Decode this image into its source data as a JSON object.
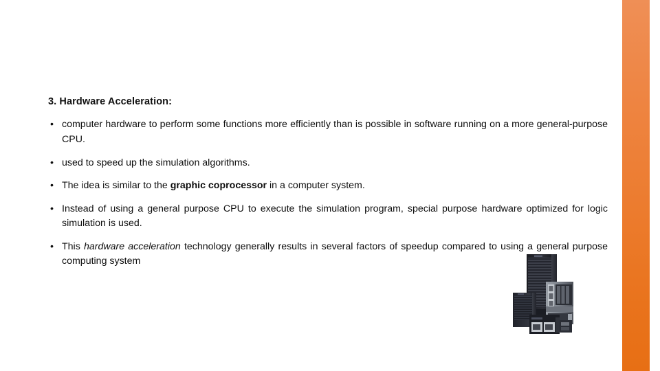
{
  "slide": {
    "heading": "3. Hardware Acceleration:",
    "bullet_marker": "•",
    "bullets": [
      {
        "id": "bullet-1",
        "parts": [
          {
            "text": "computer hardware to perform some functions more efficiently than is possible in software running on a more general-purpose CPU.",
            "style": "normal"
          }
        ]
      },
      {
        "id": "bullet-2",
        "parts": [
          {
            "text": "used to speed up the simulation algorithms.",
            "style": "normal"
          }
        ]
      },
      {
        "id": "bullet-3",
        "parts": [
          {
            "text": "The idea is similar to the ",
            "style": "normal"
          },
          {
            "text": "graphic coprocessor",
            "style": "bold"
          },
          {
            "text": " in a computer system.",
            "style": "normal"
          }
        ]
      },
      {
        "id": "bullet-4",
        "parts": [
          {
            "text": "Instead of using a general purpose CPU to execute the simulation program, special purpose hardware optimized for logic simulation is used.",
            "style": "normal"
          }
        ]
      },
      {
        "id": "bullet-5",
        "parts": [
          {
            "text": "This ",
            "style": "normal"
          },
          {
            "text": "hardware acceleration",
            "style": "italic"
          },
          {
            "text": " technology generally results in several factors of speedup compared to using a general purpose computing system",
            "style": "normal"
          }
        ]
      }
    ]
  },
  "decor": {
    "accent_strip_top_color": "#EF8F56",
    "accent_strip_bottom_color": "#E76F14",
    "background_color": "#FFFFFF",
    "text_color": "#0D0D0D"
  },
  "image": {
    "server_photo_alt": "group of dark tower server computers",
    "tower_dark_color": "#23242B",
    "tower_light_color": "#8C9099"
  }
}
